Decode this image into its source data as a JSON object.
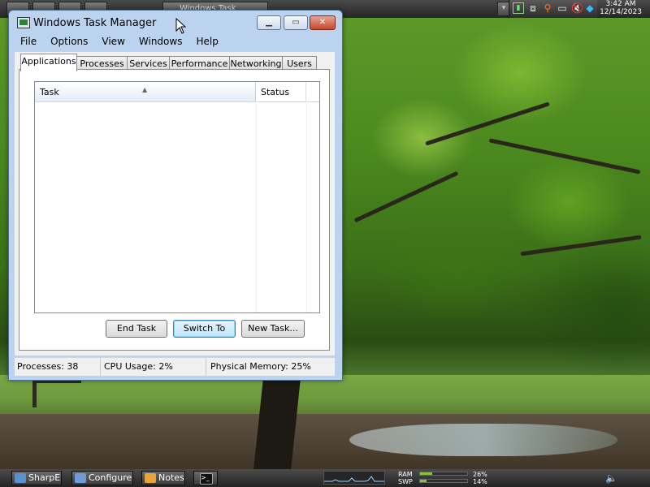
{
  "top_bar": {
    "window_button_label": "Windows Task Manager",
    "clock_time": "3:42 AM",
    "clock_date": "12/14/2023",
    "tray_icons": [
      "terminal-icon",
      "network-disconnected-icon",
      "search-icon",
      "display-icon",
      "volume-muted-icon",
      "diamond-icon"
    ]
  },
  "window": {
    "title": "Windows Task Manager",
    "menu": [
      "File",
      "Options",
      "View",
      "Windows",
      "Help"
    ],
    "tabs": [
      "Applications",
      "Processes",
      "Services",
      "Performance",
      "Networking",
      "Users"
    ],
    "active_tab": "Applications",
    "list_columns": {
      "task": "Task",
      "status": "Status"
    },
    "buttons": {
      "end_task": "End Task",
      "switch_to": "Switch To",
      "new_task": "New Task..."
    },
    "status": {
      "processes": "Processes: 38",
      "cpu": "CPU Usage: 2%",
      "memory": "Physical Memory: 25%"
    }
  },
  "taskbar": {
    "buttons": [
      "SharpE",
      "Configure",
      "Notes",
      ""
    ],
    "ram_label": "RAM",
    "ram_value": "26%",
    "ram_fraction": 0.26,
    "swp_label": "SWP",
    "swp_value": "14%",
    "swp_fraction": 0.14
  },
  "colors": {
    "accent_blue": "#3c7fb1",
    "meter_green": "#8cbf3a",
    "close_red": "#c7472d"
  }
}
